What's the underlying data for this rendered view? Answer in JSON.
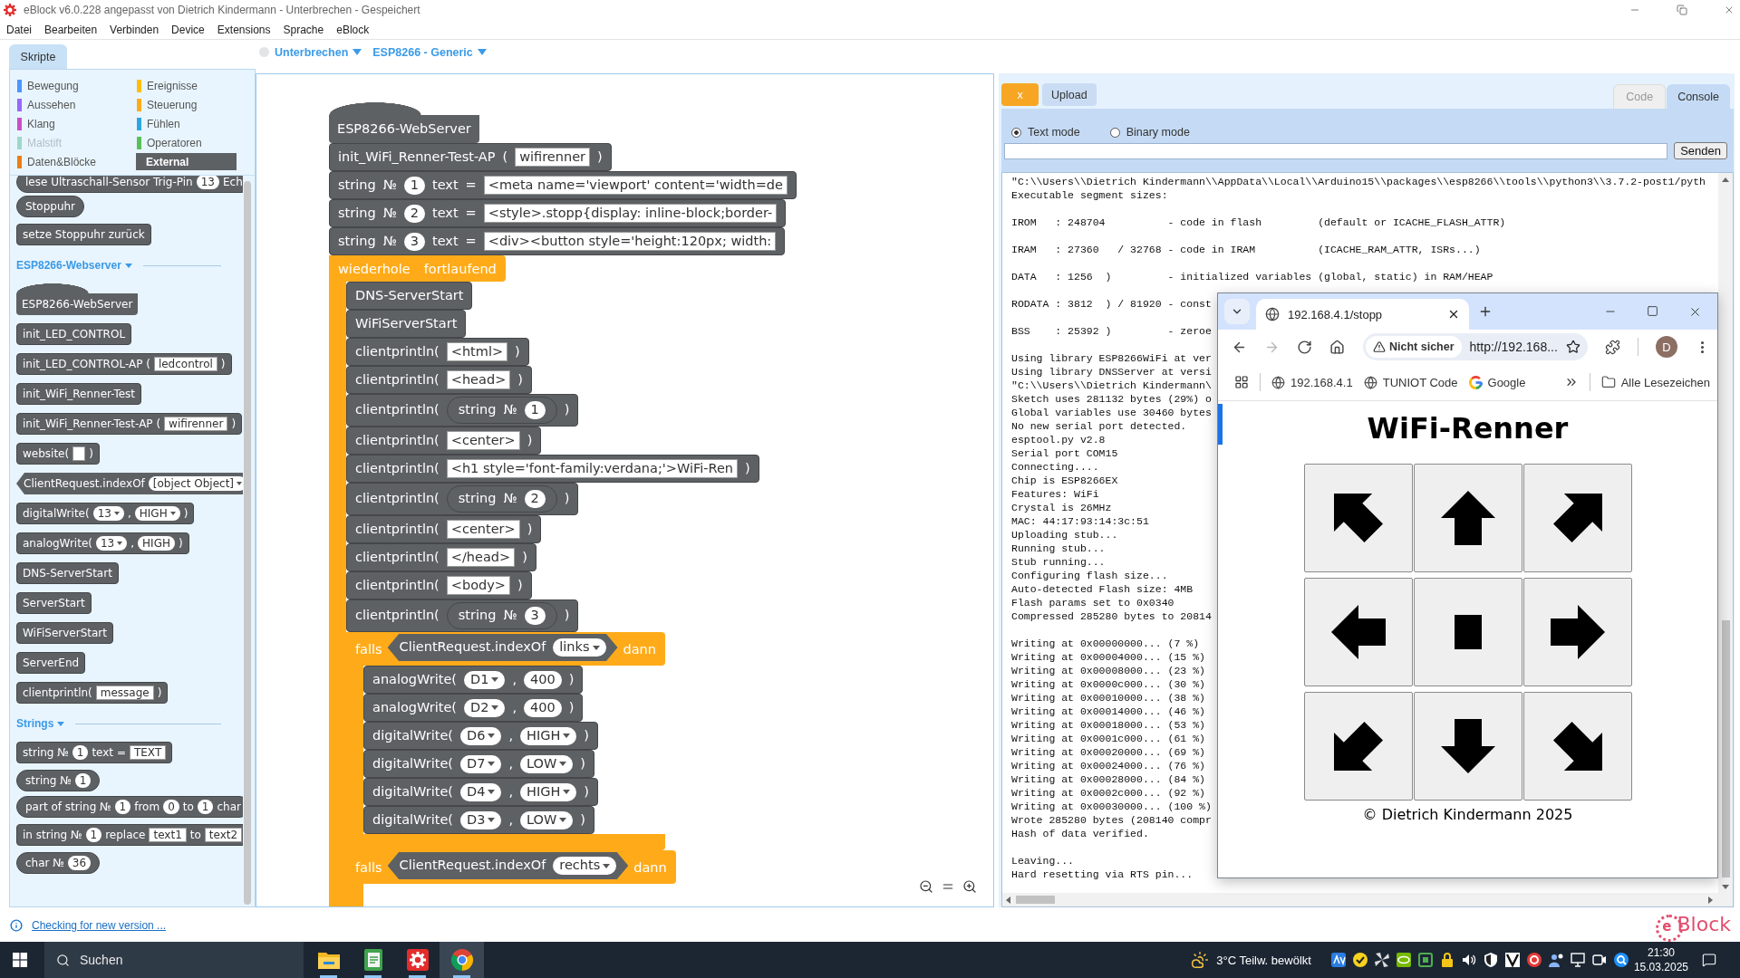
{
  "window": {
    "title": "eBlock v6.0.228 angepasst von Dietrich Kindermann - Unterbrechen - Gespeichert"
  },
  "menu": [
    "Datei",
    "Bearbeiten",
    "Verbinden",
    "Device",
    "Extensions",
    "Sprache",
    "eBlock"
  ],
  "tabs": [
    {
      "label": "Skripte",
      "selected": true
    }
  ],
  "connection": {
    "connected": false,
    "status": "Unterbrechen",
    "board": "ESP8266 - Generic"
  },
  "palette": {
    "categories": [
      {
        "label": "Bewegung",
        "color": "#4c97ff",
        "selected": false,
        "disabled": false
      },
      {
        "label": "Ereignisse",
        "color": "#ffbf00",
        "selected": false,
        "disabled": false
      },
      {
        "label": "Aussehen",
        "color": "#9966ff",
        "selected": false,
        "disabled": false
      },
      {
        "label": "Steuerung",
        "color": "#ffab19",
        "selected": false,
        "disabled": false
      },
      {
        "label": "Klang",
        "color": "#c94fc9",
        "selected": false,
        "disabled": false
      },
      {
        "label": "Fühlen",
        "color": "#2ca5e2",
        "selected": false,
        "disabled": false
      },
      {
        "label": "Malstift",
        "color": "#9fd8c9",
        "selected": false,
        "disabled": true
      },
      {
        "label": "Operatoren",
        "color": "#59c059",
        "selected": false,
        "disabled": false
      },
      {
        "label": "Daten&Blöcke",
        "color": "#ee7d16",
        "selected": false,
        "disabled": false
      },
      {
        "label": "External",
        "color": "#5e6164",
        "selected": true,
        "disabled": false
      }
    ],
    "items": [
      {
        "kind": "reporter",
        "parts": [
          {
            "kind": "label",
            "text": "lese Ultraschall-Sensor Trig-Pin"
          },
          {
            "kind": "value",
            "text": "13"
          },
          {
            "kind": "label",
            "text": "Ech"
          }
        ]
      },
      {
        "kind": "reporter",
        "parts": [
          {
            "kind": "label",
            "text": "Stoppuhr"
          }
        ]
      },
      {
        "kind": "stack",
        "parts": [
          {
            "kind": "label",
            "text": "setze Stoppuhr zurück"
          }
        ]
      },
      {
        "kind": "header",
        "label": "ESP8266-Webserver"
      },
      {
        "kind": "hat",
        "parts": [
          {
            "kind": "label",
            "text": "ESP8266-WebServer"
          }
        ]
      },
      {
        "kind": "stack",
        "parts": [
          {
            "kind": "label",
            "text": "init_LED_CONTROL"
          }
        ]
      },
      {
        "kind": "stack",
        "parts": [
          {
            "kind": "label",
            "text": "init_LED_CONTROL-AP ("
          },
          {
            "kind": "text",
            "text": "ledcontrol"
          },
          {
            "kind": "label",
            "text": ")"
          }
        ]
      },
      {
        "kind": "stack",
        "parts": [
          {
            "kind": "label",
            "text": "init_WiFi_Renner-Test"
          }
        ]
      },
      {
        "kind": "stack",
        "parts": [
          {
            "kind": "label",
            "text": "init_WiFi_Renner-Test-AP ("
          },
          {
            "kind": "text",
            "text": "wifirenner"
          },
          {
            "kind": "label",
            "text": ")"
          }
        ]
      },
      {
        "kind": "stack",
        "parts": [
          {
            "kind": "label",
            "text": "website("
          },
          {
            "kind": "empty"
          },
          {
            "kind": "label",
            "text": ")"
          }
        ]
      },
      {
        "kind": "boolean",
        "parts": [
          {
            "kind": "label",
            "text": "ClientRequest.indexOf"
          },
          {
            "kind": "menu",
            "text": "[object Object]"
          }
        ]
      },
      {
        "kind": "stack",
        "parts": [
          {
            "kind": "label",
            "text": "digitalWrite("
          },
          {
            "kind": "menu",
            "text": "13"
          },
          {
            "kind": "label",
            "text": ","
          },
          {
            "kind": "menu",
            "text": "HIGH"
          },
          {
            "kind": "label",
            "text": ")"
          }
        ]
      },
      {
        "kind": "stack",
        "parts": [
          {
            "kind": "label",
            "text": "analogWrite("
          },
          {
            "kind": "menu",
            "text": "13"
          },
          {
            "kind": "label",
            "text": ","
          },
          {
            "kind": "value",
            "text": "HIGH"
          },
          {
            "kind": "label",
            "text": ")"
          }
        ]
      },
      {
        "kind": "stack",
        "parts": [
          {
            "kind": "label",
            "text": "DNS-ServerStart"
          }
        ]
      },
      {
        "kind": "stack",
        "parts": [
          {
            "kind": "label",
            "text": "ServerStart"
          }
        ]
      },
      {
        "kind": "stack",
        "parts": [
          {
            "kind": "label",
            "text": "WiFiServerStart"
          }
        ]
      },
      {
        "kind": "stack",
        "parts": [
          {
            "kind": "label",
            "text": "ServerEnd"
          }
        ]
      },
      {
        "kind": "stack",
        "parts": [
          {
            "kind": "label",
            "text": "clientprintln("
          },
          {
            "kind": "text",
            "text": "message"
          },
          {
            "kind": "label",
            "text": ")"
          }
        ]
      },
      {
        "kind": "header",
        "label": "Strings"
      },
      {
        "kind": "stack",
        "parts": [
          {
            "kind": "label",
            "text": "string №"
          },
          {
            "kind": "value",
            "text": "1"
          },
          {
            "kind": "label",
            "text": "text ="
          },
          {
            "kind": "text",
            "text": "TEXT"
          }
        ]
      },
      {
        "kind": "reporter",
        "parts": [
          {
            "kind": "label",
            "text": "string №"
          },
          {
            "kind": "value",
            "text": "1"
          }
        ]
      },
      {
        "kind": "reporter",
        "parts": [
          {
            "kind": "label",
            "text": "part of string №"
          },
          {
            "kind": "value",
            "text": "1"
          },
          {
            "kind": "label",
            "text": "from"
          },
          {
            "kind": "value",
            "text": "0"
          },
          {
            "kind": "label",
            "text": "to"
          },
          {
            "kind": "value",
            "text": "1"
          },
          {
            "kind": "label",
            "text": "char"
          }
        ]
      },
      {
        "kind": "stack",
        "parts": [
          {
            "kind": "label",
            "text": "in string №"
          },
          {
            "kind": "value",
            "text": "1"
          },
          {
            "kind": "label",
            "text": "replace"
          },
          {
            "kind": "text",
            "text": "text1"
          },
          {
            "kind": "label",
            "text": "to"
          },
          {
            "kind": "text",
            "text": "text2"
          }
        ]
      },
      {
        "kind": "reporter",
        "parts": [
          {
            "kind": "label",
            "text": "char №"
          },
          {
            "kind": "value",
            "text": "36"
          }
        ]
      }
    ]
  },
  "script": {
    "blocks": [
      {
        "kind": "hat",
        "parts": [
          {
            "kind": "label",
            "text": "ESP8266-WebServer"
          }
        ]
      },
      {
        "kind": "stack",
        "parts": [
          {
            "kind": "label",
            "text": "init_WiFi_Renner-Test-AP"
          },
          {
            "kind": "label",
            "text": "("
          },
          {
            "kind": "text",
            "text": "wifirenner"
          },
          {
            "kind": "label",
            "text": ")"
          }
        ]
      },
      {
        "kind": "stack",
        "parts": [
          {
            "kind": "label",
            "text": "string"
          },
          {
            "kind": "label",
            "text": "№"
          },
          {
            "kind": "value",
            "text": "1"
          },
          {
            "kind": "label",
            "text": "text"
          },
          {
            "kind": "label",
            "text": "="
          },
          {
            "kind": "text",
            "text": "<meta name='viewport' content='width=de"
          }
        ]
      },
      {
        "kind": "stack",
        "parts": [
          {
            "kind": "label",
            "text": "string"
          },
          {
            "kind": "label",
            "text": "№"
          },
          {
            "kind": "value",
            "text": "2"
          },
          {
            "kind": "label",
            "text": "text"
          },
          {
            "kind": "label",
            "text": "="
          },
          {
            "kind": "text",
            "text": "<style>.stopp{display: inline-block;border-"
          }
        ]
      },
      {
        "kind": "stack",
        "parts": [
          {
            "kind": "label",
            "text": "string"
          },
          {
            "kind": "label",
            "text": "№"
          },
          {
            "kind": "value",
            "text": "3"
          },
          {
            "kind": "label",
            "text": "text"
          },
          {
            "kind": "label",
            "text": "="
          },
          {
            "kind": "text",
            "text": "<div><button style='height:120px; width:"
          }
        ]
      },
      {
        "kind": "loop",
        "parts": [
          {
            "kind": "label",
            "text": "wiederhole"
          },
          {
            "kind": "label",
            "text": "fortlaufend"
          }
        ],
        "children": [
          {
            "kind": "stack",
            "parts": [
              {
                "kind": "label",
                "text": "DNS-ServerStart"
              }
            ]
          },
          {
            "kind": "stack",
            "parts": [
              {
                "kind": "label",
                "text": "WiFiServerStart"
              }
            ]
          },
          {
            "kind": "stack",
            "parts": [
              {
                "kind": "label",
                "text": "clientprintln("
              },
              {
                "kind": "text",
                "text": "<html>"
              },
              {
                "kind": "label",
                "text": ")"
              }
            ]
          },
          {
            "kind": "stack",
            "parts": [
              {
                "kind": "label",
                "text": "clientprintln("
              },
              {
                "kind": "text",
                "text": "<head>"
              },
              {
                "kind": "label",
                "text": ")"
              }
            ]
          },
          {
            "kind": "stack",
            "parts": [
              {
                "kind": "label",
                "text": "clientprintln("
              },
              {
                "kind": "reporter",
                "parts": [
                  {
                    "kind": "label",
                    "text": "string"
                  },
                  {
                    "kind": "label",
                    "text": "№"
                  },
                  {
                    "kind": "value",
                    "text": "1"
                  }
                ]
              },
              {
                "kind": "label",
                "text": ")"
              }
            ]
          },
          {
            "kind": "stack",
            "parts": [
              {
                "kind": "label",
                "text": "clientprintln("
              },
              {
                "kind": "text",
                "text": "<center>"
              },
              {
                "kind": "label",
                "text": ")"
              }
            ]
          },
          {
            "kind": "stack",
            "parts": [
              {
                "kind": "label",
                "text": "clientprintln("
              },
              {
                "kind": "text",
                "text": "<h1 style='font-family:verdana;'>WiFi-Ren"
              },
              {
                "kind": "label",
                "text": ")"
              }
            ]
          },
          {
            "kind": "stack",
            "parts": [
              {
                "kind": "label",
                "text": "clientprintln("
              },
              {
                "kind": "reporter",
                "parts": [
                  {
                    "kind": "label",
                    "text": "string"
                  },
                  {
                    "kind": "label",
                    "text": "№"
                  },
                  {
                    "kind": "value",
                    "text": "2"
                  }
                ]
              },
              {
                "kind": "label",
                "text": ")"
              }
            ]
          },
          {
            "kind": "stack",
            "parts": [
              {
                "kind": "label",
                "text": "clientprintln("
              },
              {
                "kind": "text",
                "text": "<center>"
              },
              {
                "kind": "label",
                "text": ")"
              }
            ]
          },
          {
            "kind": "stack",
            "parts": [
              {
                "kind": "label",
                "text": "clientprintln("
              },
              {
                "kind": "text",
                "text": "</head>"
              },
              {
                "kind": "label",
                "text": ")"
              }
            ]
          },
          {
            "kind": "stack",
            "parts": [
              {
                "kind": "label",
                "text": "clientprintln("
              },
              {
                "kind": "text",
                "text": "<body>"
              },
              {
                "kind": "label",
                "text": ")"
              }
            ]
          },
          {
            "kind": "stack",
            "parts": [
              {
                "kind": "label",
                "text": "clientprintln("
              },
              {
                "kind": "reporter",
                "parts": [
                  {
                    "kind": "label",
                    "text": "string"
                  },
                  {
                    "kind": "label",
                    "text": "№"
                  },
                  {
                    "kind": "value",
                    "text": "3"
                  }
                ]
              },
              {
                "kind": "label",
                "text": ")"
              }
            ]
          },
          {
            "kind": "if",
            "parts": [
              {
                "kind": "label",
                "text": "falls"
              },
              {
                "kind": "boolean",
                "parts": [
                  {
                    "kind": "label",
                    "text": "ClientRequest.indexOf"
                  },
                  {
                    "kind": "menu",
                    "text": "links"
                  }
                ]
              },
              {
                "kind": "label",
                "text": "dann"
              }
            ],
            "children": [
              {
                "kind": "stack",
                "parts": [
                  {
                    "kind": "label",
                    "text": "analogWrite("
                  },
                  {
                    "kind": "menu",
                    "text": "D1"
                  },
                  {
                    "kind": "label",
                    "text": ","
                  },
                  {
                    "kind": "value",
                    "text": "400"
                  },
                  {
                    "kind": "label",
                    "text": ")"
                  }
                ]
              },
              {
                "kind": "stack",
                "parts": [
                  {
                    "kind": "label",
                    "text": "analogWrite("
                  },
                  {
                    "kind": "menu",
                    "text": "D2"
                  },
                  {
                    "kind": "label",
                    "text": ","
                  },
                  {
                    "kind": "value",
                    "text": "400"
                  },
                  {
                    "kind": "label",
                    "text": ")"
                  }
                ]
              },
              {
                "kind": "stack",
                "parts": [
                  {
                    "kind": "label",
                    "text": "digitalWrite("
                  },
                  {
                    "kind": "menu",
                    "text": "D6"
                  },
                  {
                    "kind": "label",
                    "text": ","
                  },
                  {
                    "kind": "menu",
                    "text": "HIGH"
                  },
                  {
                    "kind": "label",
                    "text": ")"
                  }
                ]
              },
              {
                "kind": "stack",
                "parts": [
                  {
                    "kind": "label",
                    "text": "digitalWrite("
                  },
                  {
                    "kind": "menu",
                    "text": "D7"
                  },
                  {
                    "kind": "label",
                    "text": ","
                  },
                  {
                    "kind": "menu",
                    "text": "LOW"
                  },
                  {
                    "kind": "label",
                    "text": ")"
                  }
                ]
              },
              {
                "kind": "stack",
                "parts": [
                  {
                    "kind": "label",
                    "text": "digitalWrite("
                  },
                  {
                    "kind": "menu",
                    "text": "D4"
                  },
                  {
                    "kind": "label",
                    "text": ","
                  },
                  {
                    "kind": "menu",
                    "text": "HIGH"
                  },
                  {
                    "kind": "label",
                    "text": ")"
                  }
                ]
              },
              {
                "kind": "stack",
                "parts": [
                  {
                    "kind": "label",
                    "text": "digitalWrite("
                  },
                  {
                    "kind": "menu",
                    "text": "D3"
                  },
                  {
                    "kind": "label",
                    "text": ","
                  },
                  {
                    "kind": "menu",
                    "text": "LOW"
                  },
                  {
                    "kind": "label",
                    "text": ")"
                  }
                ]
              }
            ]
          },
          {
            "kind": "if",
            "parts": [
              {
                "kind": "label",
                "text": "falls"
              },
              {
                "kind": "boolean",
                "parts": [
                  {
                    "kind": "label",
                    "text": "ClientRequest.indexOf"
                  },
                  {
                    "kind": "menu",
                    "text": "rechts"
                  }
                ]
              },
              {
                "kind": "label",
                "text": "dann"
              }
            ]
          }
        ]
      }
    ]
  },
  "panel": {
    "buttons": [
      {
        "kind": "cancel",
        "label": "x"
      },
      {
        "kind": "upload",
        "label": "Upload"
      }
    ],
    "tabs": [
      {
        "label": "Code",
        "selected": false
      },
      {
        "label": "Console",
        "selected": true
      }
    ],
    "modes": [
      {
        "label": "Text mode",
        "selected": true
      },
      {
        "label": "Binary mode",
        "selected": false
      }
    ],
    "send": "Senden",
    "console": [
      [
        "\"C:\\\\Users\\\\Dietrich Kindermann\\\\AppData\\\\Local\\\\Arduino15\\\\packages\\\\esp8266\\\\tools\\\\python3\\\\3.7.2-post1/pyth",
        "Executable segment sizes:"
      ],
      [
        "IROM   : 248704          - code in flash         (default or ICACHE_FLASH_ATTR)"
      ],
      [
        "IRAM   : 27360   / 32768 - code in IRAM          (ICACHE_RAM_ATTR, ISRs...)"
      ],
      [
        "DATA   : 1256  )         - initialized variables (global, static) in RAM/HEAP"
      ],
      [
        "RODATA : 3812  ) / 81920 - const"
      ],
      [
        "BSS    : 25392 )         - zeroe"
      ],
      [
        "Using library ESP8266WiFi at ver",
        "Using library DNSServer at versi",
        "\"C:\\\\Users\\\\Dietrich Kindermann\\",
        "Sketch uses 281132 bytes (29%) o",
        "Global variables use 30460 bytes",
        "No new serial port detected.",
        "esptool.py v2.8",
        "Serial port COM15",
        "Connecting....",
        "Chip is ESP8266EX",
        "Features: WiFi",
        "Crystal is 26MHz",
        "MAC: 44:17:93:14:3c:51",
        "Uploading stub...",
        "Running stub...",
        "Stub running...",
        "Configuring flash size...",
        "Auto-detected Flash size: 4MB",
        "Flash params set to 0x0340",
        "Compressed 285280 bytes to 20814"
      ],
      [
        "Writing at 0x00000000... (7 %)",
        "Writing at 0x00004000... (15 %)",
        "Writing at 0x00008000... (23 %)",
        "Writing at 0x0000c000... (30 %)",
        "Writing at 0x00010000... (38 %)",
        "Writing at 0x00014000... (46 %)",
        "Writing at 0x00018000... (53 %)",
        "Writing at 0x0001c000... (61 %)",
        "Writing at 0x00020000... (69 %)",
        "Writing at 0x00024000... (76 %)",
        "Writing at 0x00028000... (84 %)",
        "Writing at 0x0002c000... (92 %)",
        "Writing at 0x00030000... (100 %)",
        "Wrote 285280 bytes (208140 compr",
        "Hash of data verified."
      ],
      [
        "Leaving...",
        "Hard resetting via RTS pin..."
      ]
    ]
  },
  "browser": {
    "tab_title": "192.168.4.1/stopp",
    "nav": [
      {
        "kind": "back",
        "disabled": false
      },
      {
        "kind": "forward",
        "disabled": true
      },
      {
        "kind": "reload",
        "disabled": false
      },
      {
        "kind": "home",
        "disabled": false
      }
    ],
    "security": "Nicht sicher",
    "address": "http://192.168...",
    "profile": "D",
    "bookmarks": [
      {
        "kind": "site",
        "label": "192.168.4.1"
      },
      {
        "kind": "site",
        "label": "TUNIOT Code"
      },
      {
        "kind": "google",
        "label": "Google"
      }
    ],
    "all_bookmarks": "Alle Lesezeichen",
    "page": {
      "heading": "WiFi-Renner",
      "pad": [
        {
          "kind": "up-left"
        },
        {
          "kind": "up"
        },
        {
          "kind": "up-right"
        },
        {
          "kind": "left"
        },
        {
          "kind": "stop"
        },
        {
          "kind": "right"
        },
        {
          "kind": "down-left"
        },
        {
          "kind": "down"
        },
        {
          "kind": "down-right"
        }
      ],
      "footer": "© Dietrich Kindermann 2025"
    }
  },
  "status_bar": {
    "link": "Checking for new version ...",
    "logo": {
      "mark": "e",
      "text": "Block"
    }
  },
  "taskbar": {
    "search": {
      "placeholder": "Suchen"
    },
    "apps": [
      {
        "kind": "folder",
        "open": true,
        "selected": false
      },
      {
        "kind": "notes",
        "open": true,
        "selected": false
      },
      {
        "kind": "eblock",
        "open": true,
        "selected": false
      },
      {
        "kind": "browser",
        "open": true,
        "selected": true
      }
    ],
    "weather": "3°C Teilw. bewölkt",
    "time": "21:30",
    "date": "15.03.2025"
  }
}
